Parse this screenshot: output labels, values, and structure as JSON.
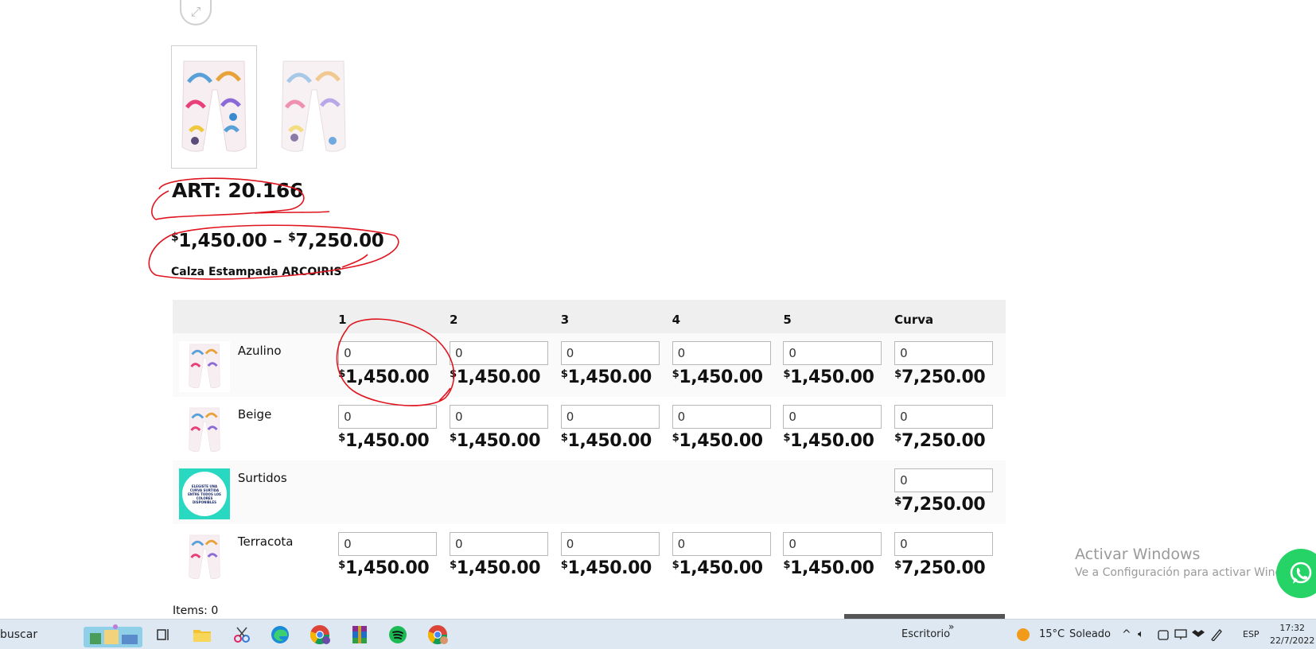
{
  "product": {
    "title": "ART: 20.166",
    "price_currency": "$",
    "price_min": "1,450.00",
    "price_separator": "–",
    "price_max": "7,250.00",
    "description": "Calza Estampada ARCOIRIS"
  },
  "grid": {
    "headers": [
      "1",
      "2",
      "3",
      "4",
      "5",
      "Curva"
    ],
    "rows": [
      {
        "name": "Azulino",
        "cells": [
          {
            "qty": "0",
            "price": "1,450.00"
          },
          {
            "qty": "0",
            "price": "1,450.00"
          },
          {
            "qty": "0",
            "price": "1,450.00"
          },
          {
            "qty": "0",
            "price": "1,450.00"
          },
          {
            "qty": "0",
            "price": "1,450.00"
          },
          {
            "qty": "0",
            "price": "7,250.00"
          }
        ]
      },
      {
        "name": "Beige",
        "cells": [
          {
            "qty": "0",
            "price": "1,450.00"
          },
          {
            "qty": "0",
            "price": "1,450.00"
          },
          {
            "qty": "0",
            "price": "1,450.00"
          },
          {
            "qty": "0",
            "price": "1,450.00"
          },
          {
            "qty": "0",
            "price": "1,450.00"
          },
          {
            "qty": "0",
            "price": "7,250.00"
          }
        ]
      },
      {
        "name": "Surtidos",
        "image_text": "ELEGISTE UNA CURVA SURTIDA ENTRE TODOS LOS COLORES DISPONIBLES",
        "cells": [
          {
            "qty": "0",
            "price": "7,250.00"
          }
        ]
      },
      {
        "name": "Terracota",
        "cells": [
          {
            "qty": "0",
            "price": "1,450.00"
          },
          {
            "qty": "0",
            "price": "1,450.00"
          },
          {
            "qty": "0",
            "price": "1,450.00"
          },
          {
            "qty": "0",
            "price": "1,450.00"
          },
          {
            "qty": "0",
            "price": "1,450.00"
          },
          {
            "qty": "0",
            "price": "7,250.00"
          }
        ]
      }
    ],
    "items_label": "Items: 0"
  },
  "watermark": {
    "line1": "Activar Windows",
    "line2": "Ve a Configuración para activar Windows."
  },
  "taskbar": {
    "search_text": "buscar",
    "desktop_label": "Escritorio",
    "weather_temp": "15°C",
    "weather_desc": "Soleado",
    "language": "ESP",
    "time": "17:32",
    "date": "22/7/2022"
  },
  "colors": {
    "annotation": "#e0141e",
    "header_bg": "#efefef",
    "whatsapp": "#25d366",
    "taskbar": "#dde8f3"
  },
  "icons": [
    "expand-icon",
    "whatsapp-icon",
    "task-view-icon",
    "file-explorer-icon",
    "snipping-icon",
    "edge-icon",
    "chrome-icon",
    "winrar-icon",
    "spotify-icon",
    "sun-icon"
  ]
}
